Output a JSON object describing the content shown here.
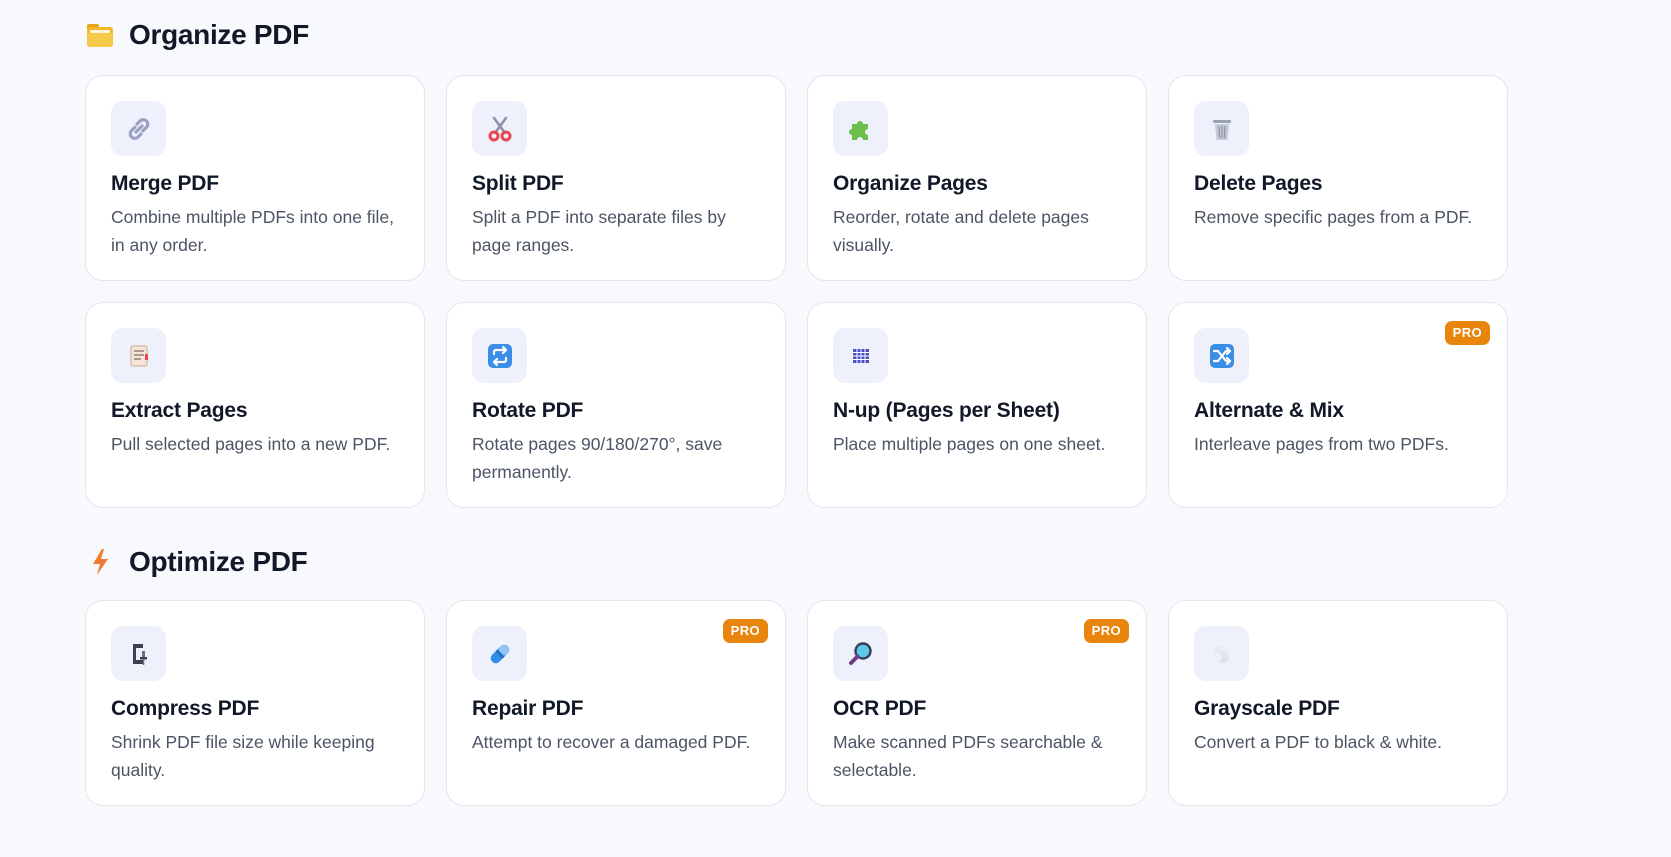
{
  "sections": [
    {
      "title": "Organize PDF",
      "icon": "folder-icon",
      "tools": [
        {
          "title": "Merge PDF",
          "desc": "Combine multiple PDFs into one file, in any order.",
          "icon": "link-icon"
        },
        {
          "title": "Split PDF",
          "desc": "Split a PDF into separate files by page ranges.",
          "icon": "scissors-icon"
        },
        {
          "title": "Organize Pages",
          "desc": "Reorder, rotate and delete pages visually.",
          "icon": "puzzle-icon"
        },
        {
          "title": "Delete Pages",
          "desc": "Remove specific pages from a PDF.",
          "icon": "trash-icon"
        },
        {
          "title": "Extract Pages",
          "desc": "Pull selected pages into a new PDF.",
          "icon": "document-icon"
        },
        {
          "title": "Rotate PDF",
          "desc": "Rotate pages 90/180/270°, save permanently.",
          "icon": "rotate-icon"
        },
        {
          "title": "N-up (Pages per Sheet)",
          "desc": "Place multiple pages on one sheet.",
          "icon": "grid-icon"
        },
        {
          "title": "Alternate & Mix",
          "desc": "Interleave pages from two PDFs.",
          "icon": "shuffle-icon",
          "badge": "PRO"
        }
      ]
    },
    {
      "title": "Optimize PDF",
      "icon": "lightning-icon",
      "tools": [
        {
          "title": "Compress PDF",
          "desc": "Shrink PDF file size while keeping quality.",
          "icon": "clamp-icon"
        },
        {
          "title": "Repair PDF",
          "desc": "Attempt to recover a damaged PDF.",
          "icon": "bandage-icon",
          "badge": "PRO"
        },
        {
          "title": "OCR PDF",
          "desc": "Make scanned PDFs searchable & selectable.",
          "icon": "magnifier-icon",
          "badge": "PRO"
        },
        {
          "title": "Grayscale PDF",
          "desc": "Convert a PDF to black & white.",
          "icon": "cloud-icon"
        }
      ]
    }
  ],
  "colors": {
    "page_bg": "#f8f9fc",
    "card_bg": "#ffffff",
    "icon_box_bg": "#eef0fb",
    "pro_badge": "#e8850c",
    "title_text": "#111827",
    "desc_text": "#4b5563"
  }
}
